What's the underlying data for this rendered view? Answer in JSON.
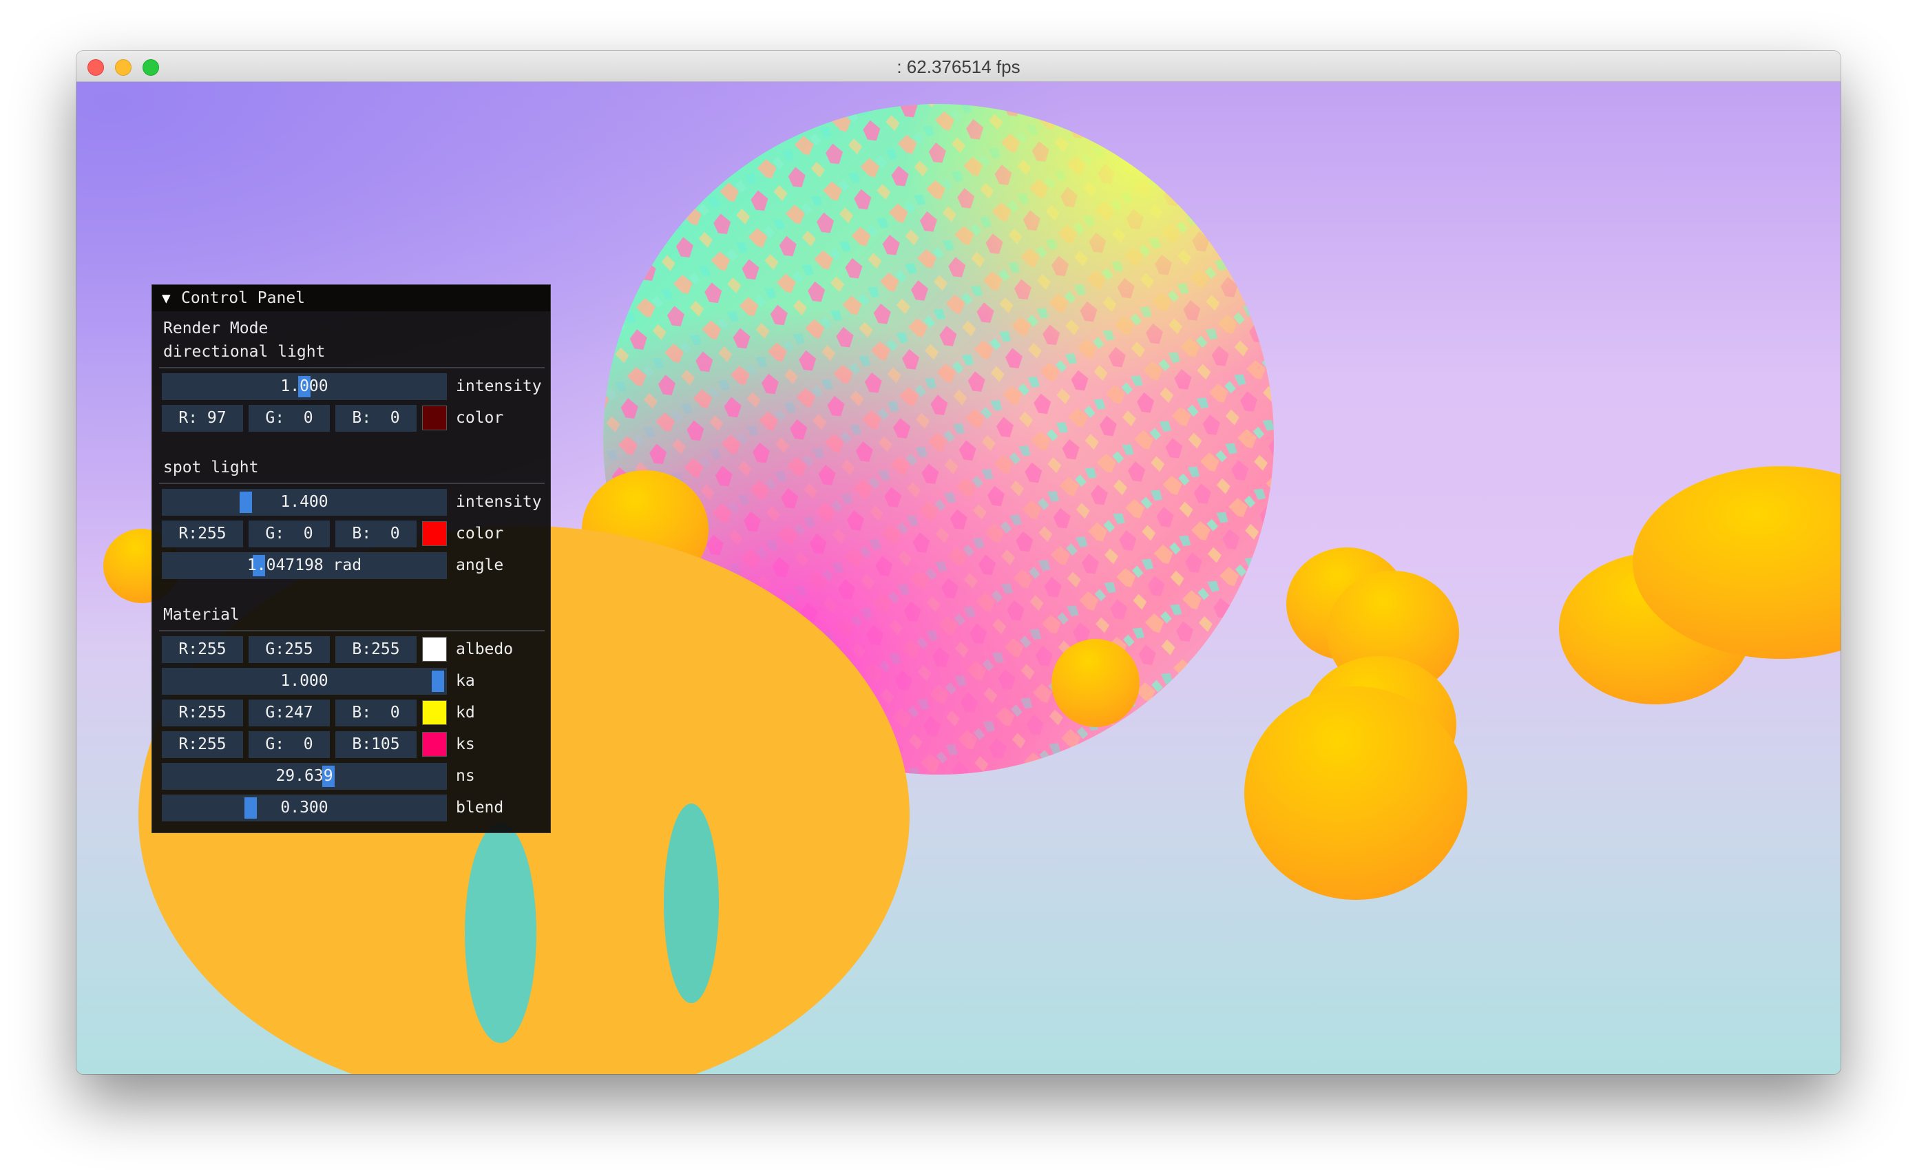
{
  "window": {
    "title": ": 62.376514 fps"
  },
  "panel": {
    "title": "Control Panel",
    "render_mode_label": "Render Mode",
    "directional": {
      "section_label": "directional light",
      "intensity": {
        "value": "1.000",
        "label": "intensity",
        "level": 0.5
      },
      "color": {
        "r": "R: 97",
        "g": "G:  0",
        "b": "B:  0",
        "label": "color",
        "swatch": "#610000"
      }
    },
    "spot": {
      "section_label": "spot light",
      "intensity": {
        "value": "1.400",
        "label": "intensity",
        "level": 0.28
      },
      "color": {
        "r": "R:255",
        "g": "G:  0",
        "b": "B:  0",
        "label": "color",
        "swatch": "#ff0000"
      },
      "angle": {
        "value": "1.047198 rad",
        "label": "angle",
        "level": 0.33
      }
    },
    "material": {
      "section_label": "Material",
      "albedo": {
        "r": "R:255",
        "g": "G:255",
        "b": "B:255",
        "label": "albedo",
        "swatch": "#ffffff"
      },
      "ka": {
        "value": "1.000",
        "label": "ka",
        "level": 1.0
      },
      "kd": {
        "r": "R:255",
        "g": "G:247",
        "b": "B:  0",
        "label": "kd",
        "swatch": "#fff700"
      },
      "ks": {
        "r": "R:255",
        "g": "G:  0",
        "b": "B:105",
        "label": "ks",
        "swatch": "#ff0069"
      },
      "ns": {
        "value": "29.639",
        "label": "ns",
        "level": 0.59
      },
      "blend": {
        "value": "0.300",
        "label": "blend",
        "level": 0.3
      }
    },
    "accent_color": "#3d85e0"
  },
  "scene": {
    "objects": [
      "patterned-sphere",
      "smiley-face",
      "yellow-blobs"
    ]
  }
}
